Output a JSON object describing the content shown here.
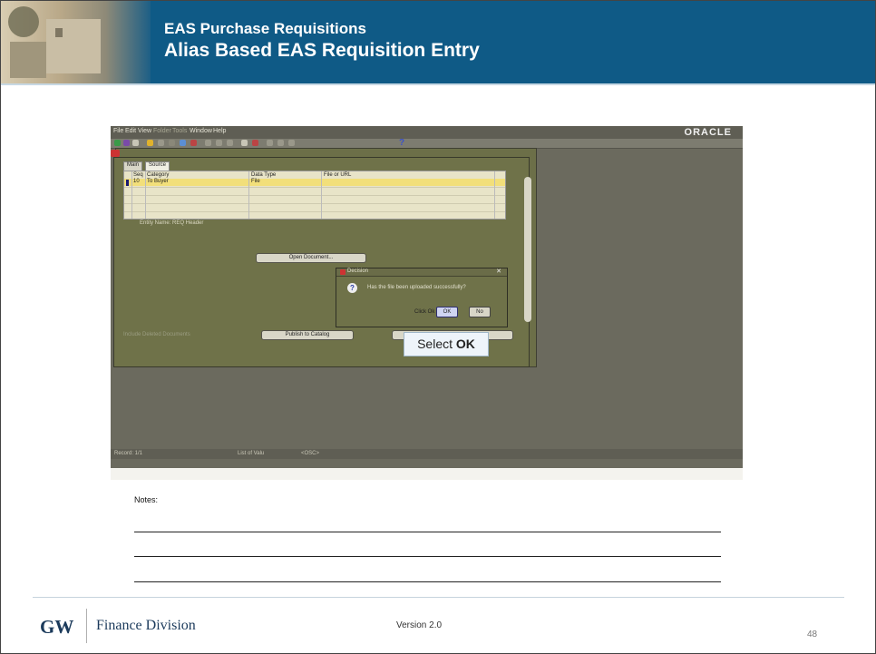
{
  "header": {
    "title_line1": "EAS Purchase Requisitions",
    "title_line2": "Alias Based EAS Requisition Entry"
  },
  "screenshot": {
    "menu": [
      "File",
      "Edit",
      "View",
      "Folder",
      "Tools",
      "Window",
      "Help"
    ],
    "brand": "ORACLE",
    "tabs": [
      "Main",
      "Source"
    ],
    "grid": {
      "columns": [
        "Seq",
        "Category",
        "Data Type",
        "File or URL"
      ],
      "row": {
        "seq": "10",
        "category": "To Buyer",
        "data_type": "File",
        "file_or_url": ""
      }
    },
    "entity_name": "Entity Name: REQ Header",
    "open_document_button": "Open Document...",
    "include_deleted": "Include Deleted Documents",
    "publish_button": "Publish to Catalog",
    "dialog": {
      "title": "Decision",
      "message": "Has the file been uploaded successfully?",
      "click_hint": "Click Ok",
      "ok_label": "OK",
      "no_label": "No"
    },
    "status": {
      "record": "Record: 1/1",
      "list_of_values": "List of Valu",
      "osc": "<OSC>"
    }
  },
  "callout": {
    "prefix": "Select ",
    "emphasis": "OK"
  },
  "notes": {
    "label": "Notes:"
  },
  "footer": {
    "logo": "GW",
    "org": "Finance Division",
    "version": "Version 2.0",
    "page_number": "48"
  }
}
